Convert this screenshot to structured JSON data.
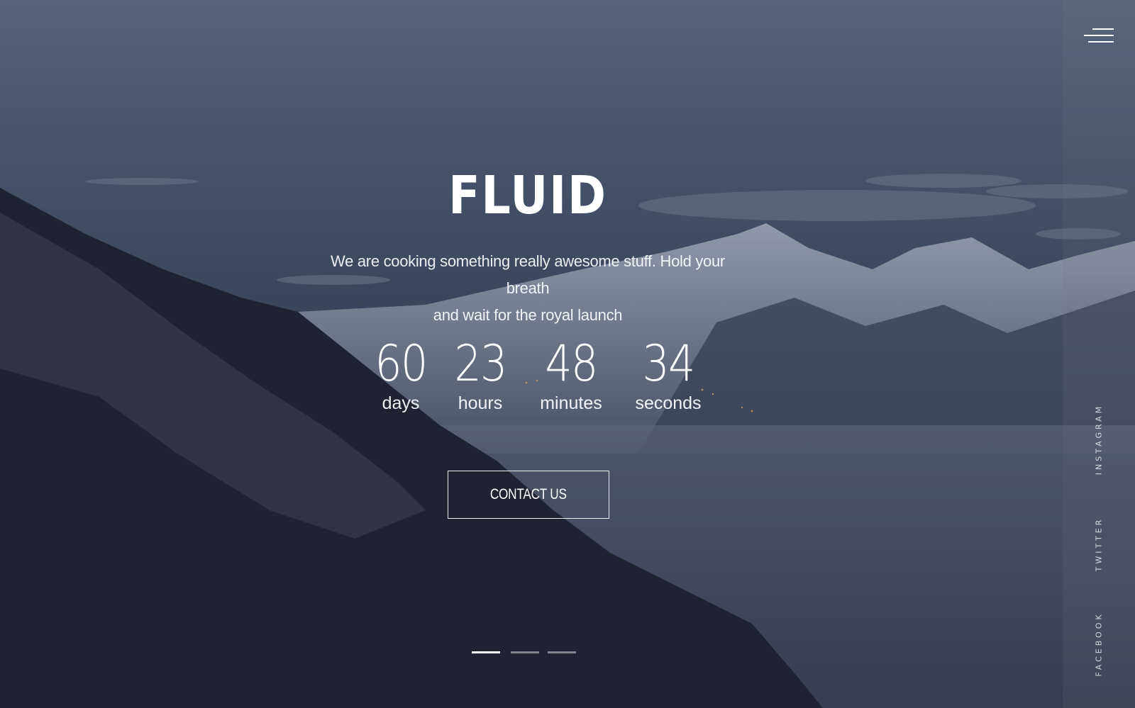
{
  "hero": {
    "title": "FLUID",
    "subtitle_line1": "We are cooking something really awesome stuff. Hold your breath",
    "subtitle_line2": "and wait for the royal launch"
  },
  "countdown": {
    "days": {
      "value": "60",
      "label": "days"
    },
    "hours": {
      "value": "23",
      "label": "hours"
    },
    "minutes": {
      "value": "48",
      "label": "minutes"
    },
    "seconds": {
      "value": "34",
      "label": "seconds"
    }
  },
  "cta": {
    "label": "CONTACT US"
  },
  "sidebar": {
    "menu_icon": "hamburger-menu-icon",
    "social": [
      "INSTAGRAM",
      "TWITTER",
      "FACEBOOK"
    ]
  },
  "slider": {
    "slides": 3,
    "active_index": 0
  },
  "colors": {
    "sky_top": "#4d5a72",
    "sky_bottom": "#252b3c",
    "accent": "#ffffff"
  }
}
